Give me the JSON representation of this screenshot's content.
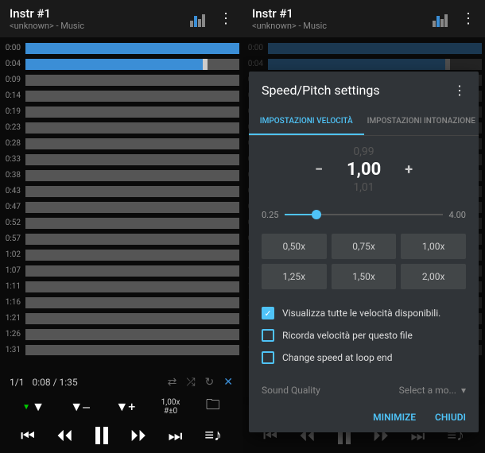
{
  "header": {
    "title": "Instr #1",
    "subtitle": "<unknown> - Music"
  },
  "times": [
    "0:00",
    "0:04",
    "0:09",
    "0:14",
    "0:19",
    "0:23",
    "0:28",
    "0:33",
    "0:38",
    "0:43",
    "0:47",
    "0:52",
    "0:57",
    "1:02",
    "1:07",
    "1:11",
    "1:16",
    "1:21",
    "1:26",
    "1:31"
  ],
  "playback": {
    "track": "1/1",
    "position": "0:08 / 1:35"
  },
  "speed_display": {
    "top": "1,00x",
    "bottom": "#±0"
  },
  "modal": {
    "title": "Speed/Pitch settings",
    "tabs": {
      "speed": "IMPOSTAZIONI VELOCITÀ",
      "pitch": "IMPOSTAZIONI INTONAZIONE"
    },
    "prev": "0,99",
    "current": "1,00",
    "next": "1,01",
    "slider": {
      "min": "0.25",
      "max": "4.00",
      "pct": 20
    },
    "presets": [
      "0,50x",
      "0,75x",
      "1,00x",
      "1,25x",
      "1,50x",
      "2,00x"
    ],
    "checks": [
      {
        "label": "Visualizza tutte le velocità disponibili.",
        "checked": true
      },
      {
        "label": "Ricorda velocità per questo file",
        "checked": false
      },
      {
        "label": "Change speed at loop end",
        "checked": false
      }
    ],
    "quality": {
      "label": "Sound Quality",
      "value": "Select a mo..."
    },
    "buttons": {
      "minimize": "MINIMIZE",
      "close": "CHIUDI"
    }
  }
}
